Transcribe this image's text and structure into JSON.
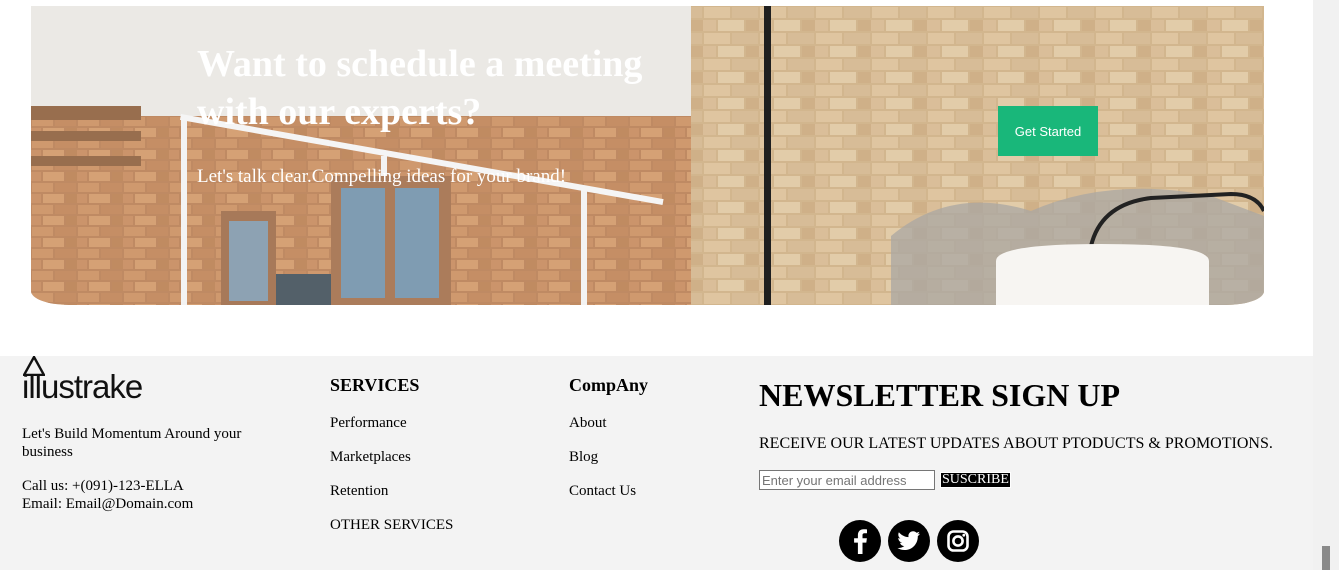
{
  "banner": {
    "title_line1": "Want to schedule a meeting",
    "title_line2": "with our experts?",
    "subtitle": "Let's talk clear.Compelling ideas for your brand!",
    "cta_label": "Get Started",
    "cta_color": "#19b77a"
  },
  "footer": {
    "brand": {
      "name": "illustrake",
      "tagline": "Let's Build Momentum Around your business",
      "call": "Call us: +(091)-123-ELLA",
      "email": "Email: Email@Domain.com"
    },
    "services": {
      "heading": "SERVICES",
      "links": [
        "Performance",
        "Marketplaces",
        "Retention",
        "OTHER SERVICES"
      ]
    },
    "company": {
      "heading": "CompAny",
      "links": [
        "About",
        "Blog",
        "Contact Us"
      ]
    },
    "newsletter": {
      "heading": "NEWSLETTER SIGN UP",
      "subtitle": "RECEIVE OUR LATEST UPDATES ABOUT PTODUCTS & PROMOTIONS.",
      "email_placeholder": "Enter your email address",
      "subscribe_label": "SUSCRIBE"
    },
    "social": [
      "facebook-icon",
      "twitter-icon",
      "instagram-icon"
    ]
  }
}
